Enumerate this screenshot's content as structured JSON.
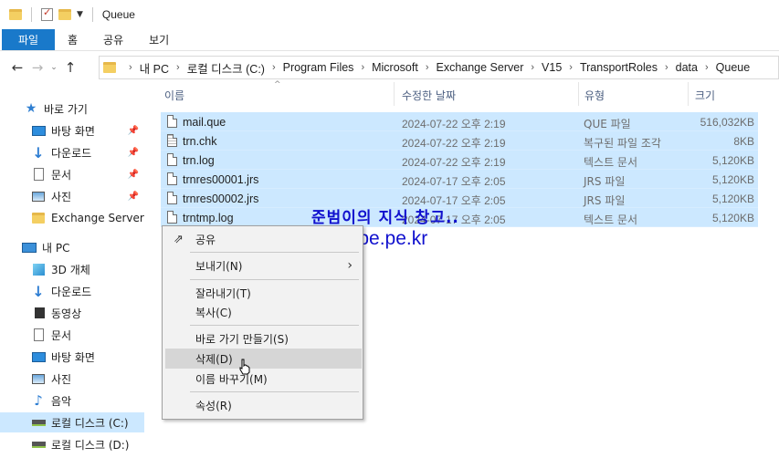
{
  "window": {
    "title": "Queue"
  },
  "ribbon": {
    "tabs": [
      "파일",
      "홈",
      "공유",
      "보기"
    ]
  },
  "nav_buttons": {
    "back": "←",
    "forward": "→",
    "recent": "⌄",
    "up": "↑"
  },
  "address": {
    "crumbs": [
      "내 PC",
      "로컬 디스크 (C:)",
      "Program Files",
      "Microsoft",
      "Exchange Server",
      "V15",
      "TransportRoles",
      "data",
      "Queue"
    ]
  },
  "sidebar": {
    "quick_access": "바로 가기",
    "pinned": [
      "바탕 화면",
      "다운로드",
      "문서",
      "사진"
    ],
    "recent_folder": "Exchange Server",
    "this_pc": "내 PC",
    "pc_items": [
      "3D 개체",
      "다운로드",
      "동영상",
      "문서",
      "바탕 화면",
      "사진",
      "음악",
      "로컬 디스크 (C:)",
      "로컬 디스크 (D:)"
    ]
  },
  "columns": {
    "name": "이름",
    "date": "수정한 날짜",
    "type": "유형",
    "size": "크기"
  },
  "files": [
    {
      "name": "mail.que",
      "date": "2024-07-22 오후 2:19",
      "type": "QUE 파일",
      "size": "516,032KB"
    },
    {
      "name": "trn.chk",
      "date": "2024-07-22 오후 2:19",
      "type": "복구된 파일 조각",
      "size": "8KB"
    },
    {
      "name": "trn.log",
      "date": "2024-07-22 오후 2:19",
      "type": "텍스트 문서",
      "size": "5,120KB"
    },
    {
      "name": "trnres00001.jrs",
      "date": "2024-07-17 오후 2:05",
      "type": "JRS 파일",
      "size": "5,120KB"
    },
    {
      "name": "trnres00002.jrs",
      "date": "2024-07-17 오후 2:05",
      "type": "JRS 파일",
      "size": "5,120KB"
    },
    {
      "name": "trntmp.log",
      "date": "2024-07-17 오후 2:05",
      "type": "텍스트 문서",
      "size": "5,120KB"
    }
  ],
  "context_menu": {
    "share": "공유",
    "send_to": "보내기(N)",
    "cut": "잘라내기(T)",
    "copy": "복사(C)",
    "create_shortcut": "바로 가기 만들기(S)",
    "delete": "삭제(D)",
    "rename": "이름 바꾸기(M)",
    "properties": "속성(R)"
  },
  "watermark": {
    "line1": "준범이의 지식 창고..",
    "line2": "hope.pe.kr"
  },
  "colors": {
    "accent": "#1979ca",
    "selection": "#cce8ff",
    "watermark": "#1010ce"
  }
}
